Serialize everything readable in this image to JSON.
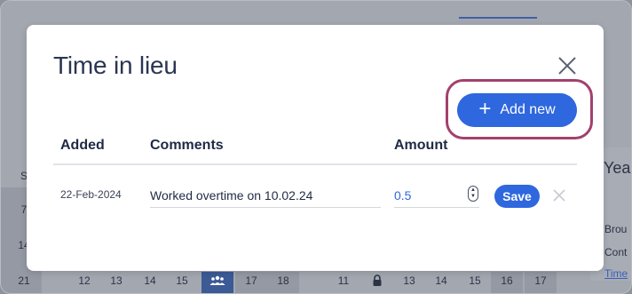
{
  "background": {
    "left_column_numbers": [
      "S",
      "7",
      "14",
      "21"
    ],
    "bottom_row_days": [
      "12",
      "13",
      "14",
      "15",
      "",
      "17",
      "18",
      "",
      "11",
      "",
      "13",
      "14",
      "15",
      "16",
      "17"
    ],
    "right_panel": {
      "year_label": "Yea",
      "line1": "Brou",
      "line2": "Cont",
      "link": "Time"
    },
    "colors": {
      "overlay": "#8e939d",
      "accent": "#3b5a96"
    }
  },
  "modal": {
    "title": "Time in lieu",
    "add_button_label": "Add new",
    "columns": {
      "added": "Added",
      "comments": "Comments",
      "amount": "Amount"
    },
    "row": {
      "date": "22-Feb-2024",
      "comment": "Worked overtime on 10.02.24",
      "amount": "0.5",
      "save_label": "Save"
    },
    "icons": {
      "close": "close-icon",
      "plus": "plus-icon",
      "cancel_row": "close-icon",
      "stepper": "stepper-icon"
    },
    "colors": {
      "primary": "#2e67de",
      "highlight": "#a2416c",
      "title": "#2a3552"
    }
  }
}
